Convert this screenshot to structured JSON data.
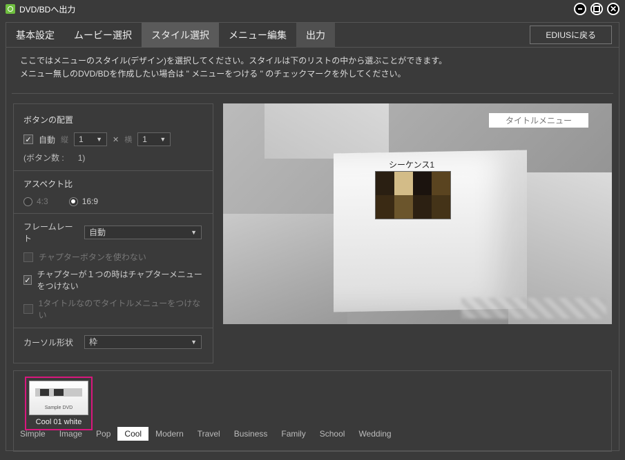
{
  "window": {
    "title": "DVD/BDへ出力"
  },
  "tabs": {
    "items": [
      "基本設定",
      "ムービー選択",
      "スタイル選択",
      "メニュー編集",
      "出力"
    ],
    "active_index": 2
  },
  "return_button": "EDIUSに戻る",
  "description": {
    "line1": "ここではメニューのスタイル(デザイン)を選択してください。スタイルは下のリストの中から選ぶことができます。",
    "line2": "メニュー無しのDVD/BDを作成したい場合は \" メニューをつける \" のチェックマークを外してください。"
  },
  "settings": {
    "button_layout_label": "ボタンの配置",
    "auto_label": "自動",
    "vert_label": "縦",
    "horiz_label": "横",
    "vert_value": "1",
    "horiz_value": "1",
    "cross": "✕",
    "button_count_label": "(ボタン数 :",
    "button_count_value": "1)",
    "aspect_label": "アスペクト比",
    "aspect_43": "4:3",
    "aspect_169": "16:9",
    "framerate_label": "フレームレート",
    "framerate_value": "自動",
    "chk_no_chapter_btn": "チャプターボタンを使わない",
    "chk_single_chapter": "チャプターが１つの時はチャプターメニューをつけない",
    "chk_single_title": "1タイトルなのでタイトルメニューをつけない",
    "cursor_label": "カーソル形状",
    "cursor_value": "枠"
  },
  "preview": {
    "title_menu": "タイトルメニュー",
    "sequence_label": "シーケンス1"
  },
  "styles": {
    "selected_caption": "Cool 01 white",
    "thumb_text": "Sample DVD"
  },
  "categories": {
    "items": [
      "Simple",
      "Image",
      "Pop",
      "Cool",
      "Modern",
      "Travel",
      "Business",
      "Family",
      "School",
      "Wedding"
    ],
    "active_index": 3
  }
}
